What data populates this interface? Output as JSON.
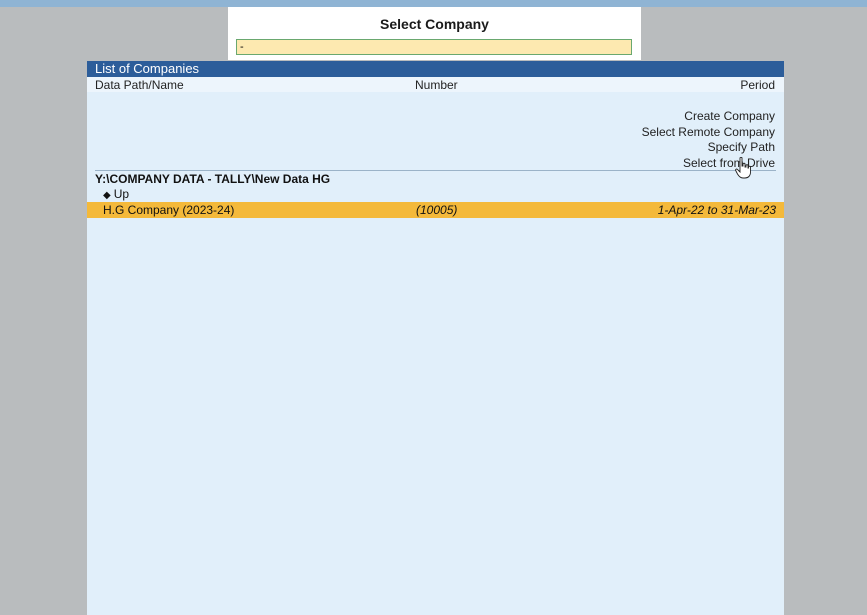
{
  "select_company": {
    "title": "Select Company",
    "input_value": "-"
  },
  "list": {
    "header": "List of Companies",
    "columns": {
      "name": "Data Path/Name",
      "number": "Number",
      "period": "Period"
    },
    "actions": [
      "Create Company",
      "Select Remote Company",
      "Specify Path",
      "Select from Drive"
    ],
    "path": "Y:\\COMPANY DATA - TALLY\\New Data HG",
    "up_label": "Up",
    "companies": [
      {
        "name": "H.G Company (2023-24)",
        "number": "(10005)",
        "period": "1-Apr-22 to 31-Mar-23"
      }
    ]
  },
  "colors": {
    "header_bg": "#2c5d9a",
    "panel_bg": "#e1effa",
    "highlight": "#f4b93a",
    "input_bg": "#fde9b0"
  }
}
